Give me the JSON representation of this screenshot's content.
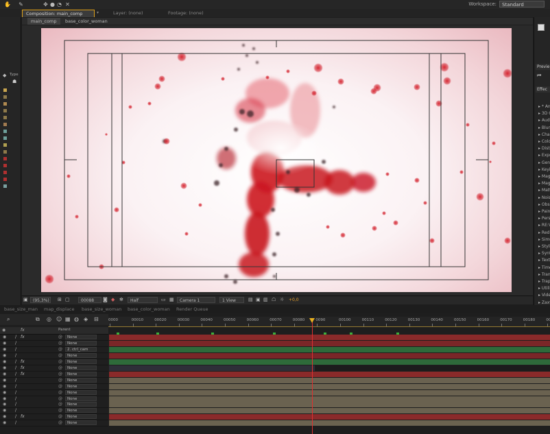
{
  "topbar": {
    "workspace_label": "Workspace:",
    "workspace_value": "Standard"
  },
  "panel_tabs": {
    "composition": "Composition: main_comp",
    "layer": "Layer: (none)",
    "footage": "Footage: (none)"
  },
  "comp_subtabs": [
    "main_comp",
    "base_color_woman"
  ],
  "project_panel": {
    "type_header": "Type"
  },
  "viewer_bar": {
    "zoom": "(95,3%)",
    "timecode": "00088",
    "resolution": "Half",
    "camera": "Camera 1",
    "views": "1 View",
    "exposure": "+0,0"
  },
  "right_panel": {
    "preview_header": "Previe",
    "effects_header": "Effec",
    "effect_items": [
      "* An",
      "3D C",
      "Audi",
      "Blur",
      "Chan",
      "Colo",
      "Distc",
      "Expr",
      "Gene",
      "Keyi",
      "Magi",
      "Magi",
      "Matt",
      "Nois",
      "Obso",
      "Paint",
      "Pers",
      "RE:V",
      "Red",
      "Simu",
      "Styliz",
      "Synth",
      "Text",
      "Time",
      "Trans",
      "Trap",
      "Utilit",
      "Vide",
      "Zaxw"
    ]
  },
  "timeline_tabs": [
    "base_size_man",
    "map_displace",
    "base_size_woman",
    "base_color_woman",
    "Render Queue"
  ],
  "ruler_labels": [
    "0000",
    "00010",
    "00020",
    "00030",
    "00040",
    "00050",
    "00060",
    "00070",
    "00080",
    "0090",
    "00100",
    "00110",
    "00120",
    "00130",
    "00140",
    "00150",
    "00160",
    "00170",
    "00180",
    "00190"
  ],
  "layer_header": {
    "parent": "Parent"
  },
  "layers": [
    {
      "fx": "fx",
      "parent": "None",
      "color": "#8a2a2a"
    },
    {
      "fx": "",
      "parent": "None",
      "color": "#7a2628"
    },
    {
      "fx": "",
      "parent": "2. ctrl_cam",
      "color": "#2e6a3a"
    },
    {
      "fx": "",
      "parent": "None",
      "color": "#7a2628"
    },
    {
      "fx": "fx",
      "parent": "None",
      "color": "#2e6a3a"
    },
    {
      "fx": "fx",
      "parent": "None",
      "color": "#2e2e38"
    },
    {
      "fx": "fx",
      "parent": "None",
      "color": "#8a2a2a"
    },
    {
      "fx": "",
      "parent": "None",
      "color": "#6a6250"
    },
    {
      "fx": "",
      "parent": "None",
      "color": "#6a6250"
    },
    {
      "fx": "",
      "parent": "None",
      "color": "#6a6250"
    },
    {
      "fx": "",
      "parent": "None",
      "color": "#6a6250"
    },
    {
      "fx": "",
      "parent": "None",
      "color": "#6a6250"
    },
    {
      "fx": "",
      "parent": "None",
      "color": "#6a6250"
    },
    {
      "fx": "fx",
      "parent": "None",
      "color": "#8a2a2a"
    },
    {
      "fx": "",
      "parent": "None",
      "color": "#6a6250"
    }
  ],
  "colors": {
    "accent": "#e6a02a",
    "playhead": "#e03030"
  }
}
